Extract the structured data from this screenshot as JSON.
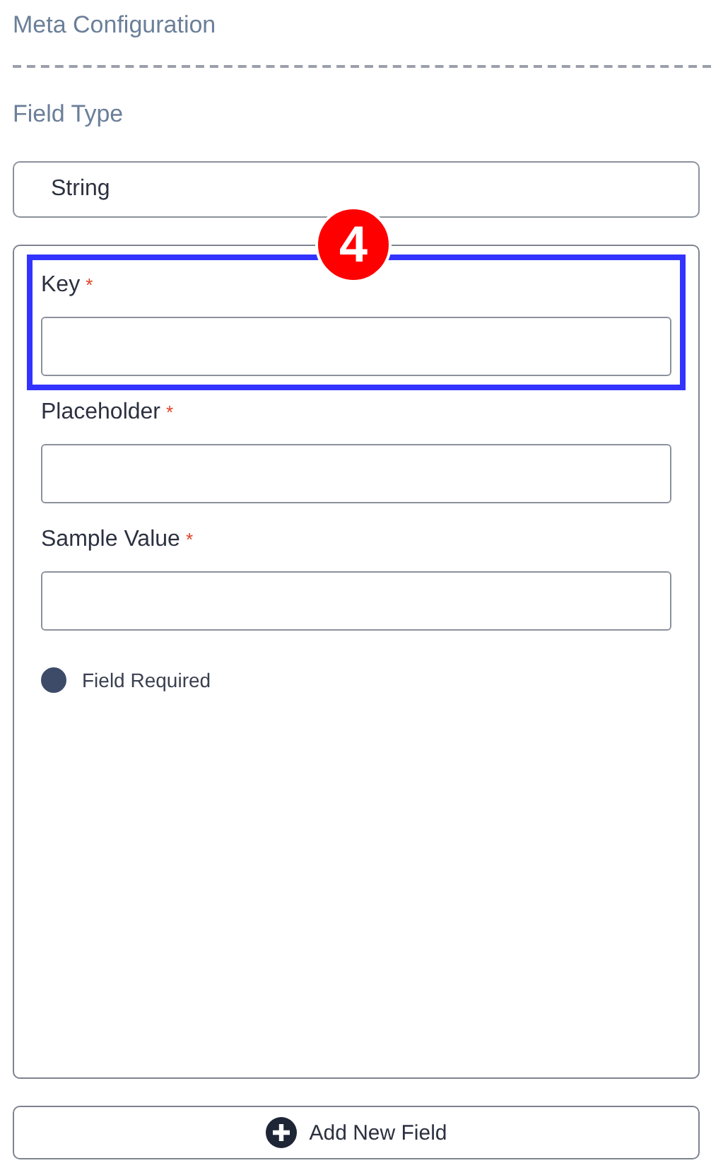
{
  "section_title": "Meta Configuration",
  "field_type": {
    "label": "Field Type",
    "value": "String"
  },
  "fields": [
    {
      "label": "Key",
      "required_mark": "*",
      "highlighted": true,
      "badge": "4"
    },
    {
      "label": "Placeholder",
      "required_mark": "*",
      "highlighted": false
    },
    {
      "label": "Sample Value",
      "required_mark": "*",
      "highlighted": false
    }
  ],
  "field_required": {
    "label": "Field Required",
    "checked": true
  },
  "add_button": {
    "label": "Add New Field"
  }
}
